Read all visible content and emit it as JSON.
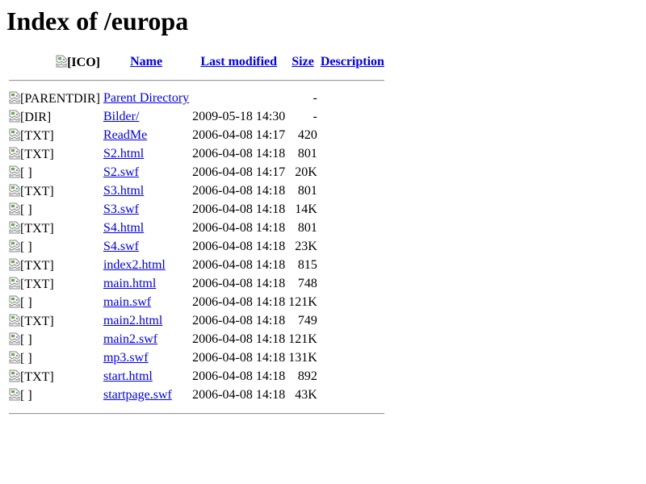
{
  "page": {
    "title": "Index of /europa"
  },
  "table": {
    "header": {
      "icon_alt": "[ICO]",
      "name": "Name",
      "last_modified": "Last modified",
      "size": "Size",
      "description": "Description"
    },
    "rows": [
      {
        "icon": "[PARENTDIR]",
        "name": "Parent Directory",
        "modified": "",
        "size": "-",
        "description": ""
      },
      {
        "icon": "[DIR]",
        "name": "Bilder/",
        "modified": "2009-05-18 14:30",
        "size": "-",
        "description": ""
      },
      {
        "icon": "[TXT]",
        "name": "ReadMe",
        "modified": "2006-04-08 14:17",
        "size": "420",
        "description": ""
      },
      {
        "icon": "[TXT]",
        "name": "S2.html",
        "modified": "2006-04-08 14:18",
        "size": "801",
        "description": ""
      },
      {
        "icon": "[ ]",
        "name": "S2.swf",
        "modified": "2006-04-08 14:17",
        "size": "20K",
        "description": ""
      },
      {
        "icon": "[TXT]",
        "name": "S3.html",
        "modified": "2006-04-08 14:18",
        "size": "801",
        "description": ""
      },
      {
        "icon": "[ ]",
        "name": "S3.swf",
        "modified": "2006-04-08 14:18",
        "size": "14K",
        "description": ""
      },
      {
        "icon": "[TXT]",
        "name": "S4.html",
        "modified": "2006-04-08 14:18",
        "size": "801",
        "description": ""
      },
      {
        "icon": "[ ]",
        "name": "S4.swf",
        "modified": "2006-04-08 14:18",
        "size": "23K",
        "description": ""
      },
      {
        "icon": "[TXT]",
        "name": "index2.html",
        "modified": "2006-04-08 14:18",
        "size": "815",
        "description": ""
      },
      {
        "icon": "[TXT]",
        "name": "main.html",
        "modified": "2006-04-08 14:18",
        "size": "748",
        "description": ""
      },
      {
        "icon": "[ ]",
        "name": "main.swf",
        "modified": "2006-04-08 14:18",
        "size": "121K",
        "description": ""
      },
      {
        "icon": "[TXT]",
        "name": "main2.html",
        "modified": "2006-04-08 14:18",
        "size": "749",
        "description": ""
      },
      {
        "icon": "[ ]",
        "name": "main2.swf",
        "modified": "2006-04-08 14:18",
        "size": "121K",
        "description": ""
      },
      {
        "icon": "[ ]",
        "name": "mp3.swf",
        "modified": "2006-04-08 14:18",
        "size": "131K",
        "description": ""
      },
      {
        "icon": "[TXT]",
        "name": "start.html",
        "modified": "2006-04-08 14:18",
        "size": "892",
        "description": ""
      },
      {
        "icon": "[ ]",
        "name": "startpage.swf",
        "modified": "2006-04-08 14:18",
        "size": "43K",
        "description": ""
      }
    ]
  },
  "icons": {
    "broken_image": "broken-image-icon"
  },
  "colors": {
    "link": "#0000ee",
    "rule": "#9a9a9a",
    "background": "#ffffff",
    "text": "#000000"
  }
}
